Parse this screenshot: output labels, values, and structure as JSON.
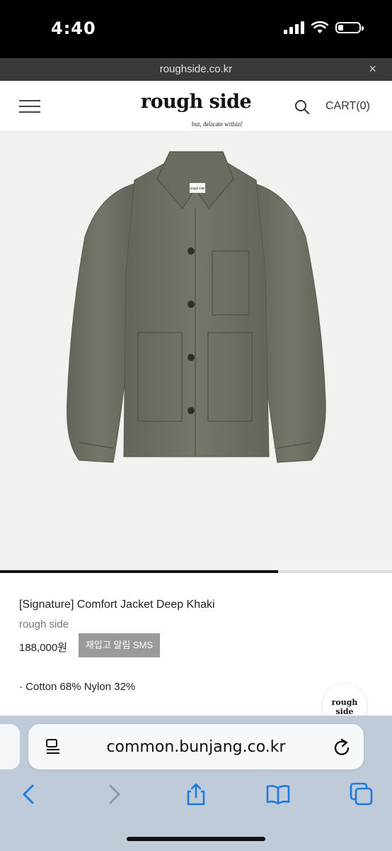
{
  "status_bar": {
    "time": "4:40"
  },
  "browser_strip": {
    "domain": "roughside.co.kr",
    "close_glyph": "×"
  },
  "header": {
    "logo": "rough side",
    "tagline": "but, delicate within!",
    "cart_label": "CART(0)",
    "icons": [
      "menu-icon",
      "search-icon"
    ]
  },
  "product": {
    "image_label": "rough side",
    "title": "[Signature] Comfort Jacket Deep Khaki",
    "brand": "rough side",
    "price": "188,000원",
    "restock_button": "재입고 알림 SMS",
    "spec": "· Cotton 68% Nylon 32%",
    "image_progress": 0.71,
    "jacket_color": "#6e7063"
  },
  "fab": {
    "label": "rough side"
  },
  "safari": {
    "address": "common.bunjang.co.kr",
    "icons": [
      "reader-icon",
      "reload-icon",
      "back-icon",
      "forward-icon",
      "share-icon",
      "bookmarks-icon",
      "tabs-icon"
    ],
    "accent": "#1f7ae0"
  }
}
